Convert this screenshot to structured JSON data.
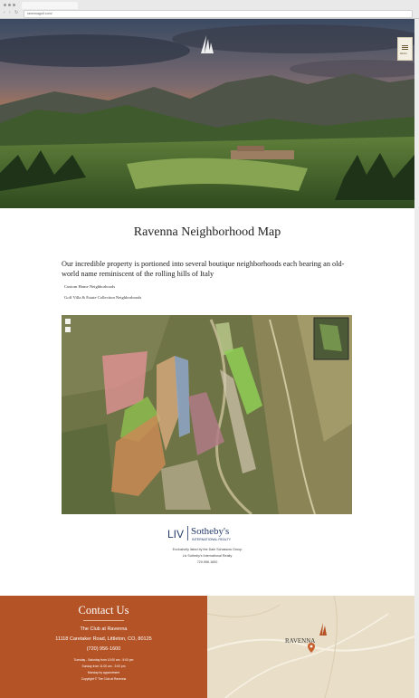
{
  "browser": {
    "url": "ravennagolf.com/"
  },
  "menu": {
    "label": "MENU"
  },
  "page": {
    "title": "Ravenna Neighborhood Map",
    "intro": "Our incredible property is portioned into several boutique neighborhoods each bearing an old-world name reminiscent of the rolling hills of Italy",
    "links": [
      "Custom Home Neighborhoods",
      "Golf Villa & Estate Collection Neighborhoods"
    ]
  },
  "broker": {
    "logo_liv": "LIV",
    "logo_sothebys": "Sotheby's",
    "logo_sub": "INTERNATIONAL REALTY",
    "line1": "Exclusively listed by the Dale Schassow Group",
    "line2": "Liv Sotheby's International Realty",
    "phone": "720.956.1600"
  },
  "contact": {
    "heading": "Contact Us",
    "club": "The Club at Ravenna",
    "address": "11118 Caretaker Road, Littleton, CO, 80125",
    "phone": "(720) 956-1600",
    "hours1": "Tuesday - Saturday from 10:00 am - 5:00 pm",
    "hours2": "Sunday from 11:00 am - 3:00 pm",
    "hours3": "Monday by appointment",
    "copyright": "Copyright © The Club at Ravenna"
  },
  "minimap": {
    "label": "RAVENNA"
  },
  "colors": {
    "accent": "#b45326",
    "map_bg": "#e9dfc9",
    "text": "#222222"
  }
}
